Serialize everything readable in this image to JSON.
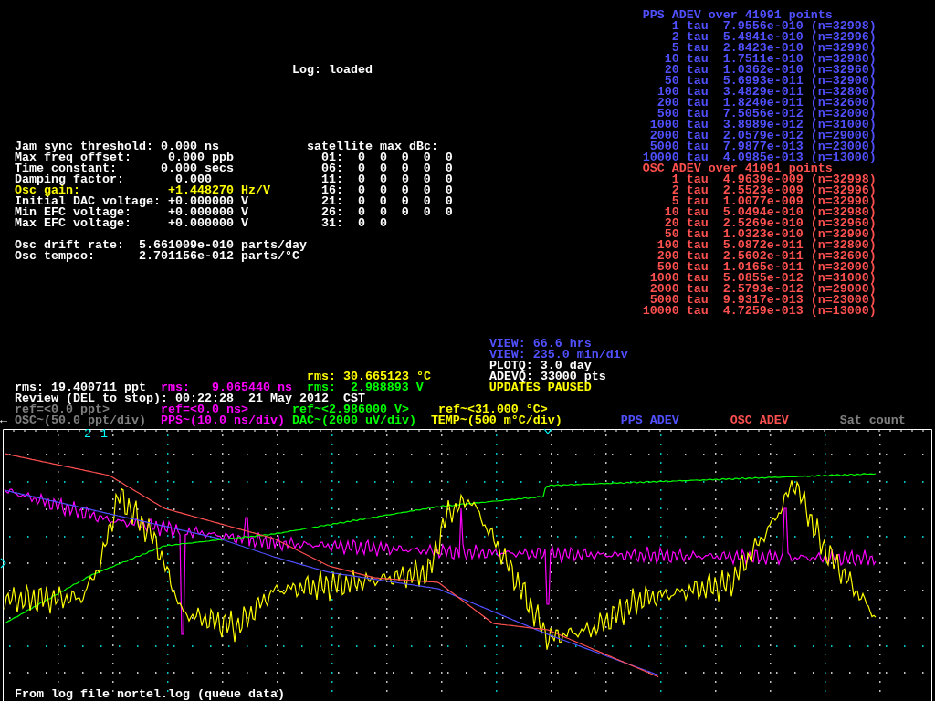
{
  "status": "Log: loaded",
  "receiver_settings": [
    {
      "label": "Jam sync threshold:",
      "value": "0.000 ns",
      "highlighted": false
    },
    {
      "label": "Max freq offset:",
      "value": "0.000 ppb",
      "highlighted": false
    },
    {
      "label": "Time constant:",
      "value": "0.000 secs",
      "highlighted": false
    },
    {
      "label": "Damping factor:",
      "value": "0.000",
      "highlighted": false
    },
    {
      "label": "Osc gain:",
      "value": "+1.448270 Hz/V",
      "highlighted": true
    },
    {
      "label": "Initial DAC voltage:",
      "value": "+0.000000 V",
      "highlighted": false
    },
    {
      "label": "Min EFC voltage:",
      "value": "+0.000000 V",
      "highlighted": false
    },
    {
      "label": "Max EFC voltage:",
      "value": "+0.000000 V",
      "highlighted": false
    }
  ],
  "osc_stats": [
    {
      "label": "Osc drift rate:",
      "value": "5.661009e-010 parts/day"
    },
    {
      "label": "Osc tempco:",
      "value": "2.701156e-012 parts/°C"
    }
  ],
  "satellite_table": {
    "title": "satellite max dBc:",
    "rows": [
      {
        "prn": "01:",
        "values": [
          "0",
          "0",
          "0",
          "0",
          "0"
        ]
      },
      {
        "prn": "06:",
        "values": [
          "0",
          "0",
          "0",
          "0",
          "0"
        ]
      },
      {
        "prn": "11:",
        "values": [
          "0",
          "0",
          "0",
          "0",
          "0"
        ]
      },
      {
        "prn": "16:",
        "values": [
          "0",
          "0",
          "0",
          "0",
          "0"
        ]
      },
      {
        "prn": "21:",
        "values": [
          "0",
          "0",
          "0",
          "0",
          "0"
        ]
      },
      {
        "prn": "26:",
        "values": [
          "0",
          "0",
          "0",
          "0",
          "0"
        ]
      },
      {
        "prn": "31:",
        "values": [
          "0",
          "0"
        ]
      }
    ]
  },
  "adev_tables": [
    {
      "title": "PPS ADEV over 41091 points",
      "color": "#5050ff",
      "rows": [
        {
          "tau": "1",
          "unit": "tau",
          "value": "7.9556e-010",
          "count": "(n=32998)"
        },
        {
          "tau": "2",
          "unit": "tau",
          "value": "5.4841e-010",
          "count": "(n=32996)"
        },
        {
          "tau": "5",
          "unit": "tau",
          "value": "2.8423e-010",
          "count": "(n=32990)"
        },
        {
          "tau": "10",
          "unit": "tau",
          "value": "1.7511e-010",
          "count": "(n=32980)"
        },
        {
          "tau": "20",
          "unit": "tau",
          "value": "1.0362e-010",
          "count": "(n=32960)"
        },
        {
          "tau": "50",
          "unit": "tau",
          "value": "5.6993e-011",
          "count": "(n=32900)"
        },
        {
          "tau": "100",
          "unit": "tau",
          "value": "3.4829e-011",
          "count": "(n=32800)"
        },
        {
          "tau": "200",
          "unit": "tau",
          "value": "1.8240e-011",
          "count": "(n=32600)"
        },
        {
          "tau": "500",
          "unit": "tau",
          "value": "7.5056e-012",
          "count": "(n=32000)"
        },
        {
          "tau": "1000",
          "unit": "tau",
          "value": "3.8989e-012",
          "count": "(n=31000)"
        },
        {
          "tau": "2000",
          "unit": "tau",
          "value": "2.0579e-012",
          "count": "(n=29000)"
        },
        {
          "tau": "5000",
          "unit": "tau",
          "value": "7.9877e-013",
          "count": "(n=23000)"
        },
        {
          "tau": "10000",
          "unit": "tau",
          "value": "4.0985e-013",
          "count": "(n=13000)"
        }
      ]
    },
    {
      "title": "OSC ADEV over 41091 points",
      "color": "#ff5050",
      "rows": [
        {
          "tau": "1",
          "unit": "tau",
          "value": "4.9639e-009",
          "count": "(n=32998)"
        },
        {
          "tau": "2",
          "unit": "tau",
          "value": "2.5523e-009",
          "count": "(n=32996)"
        },
        {
          "tau": "5",
          "unit": "tau",
          "value": "1.0077e-009",
          "count": "(n=32990)"
        },
        {
          "tau": "10",
          "unit": "tau",
          "value": "5.0494e-010",
          "count": "(n=32980)"
        },
        {
          "tau": "20",
          "unit": "tau",
          "value": "2.5269e-010",
          "count": "(n=32960)"
        },
        {
          "tau": "50",
          "unit": "tau",
          "value": "1.0323e-010",
          "count": "(n=32900)"
        },
        {
          "tau": "100",
          "unit": "tau",
          "value": "5.0872e-011",
          "count": "(n=32800)"
        },
        {
          "tau": "200",
          "unit": "tau",
          "value": "2.5602e-011",
          "count": "(n=32600)"
        },
        {
          "tau": "500",
          "unit": "tau",
          "value": "1.0165e-011",
          "count": "(n=32000)"
        },
        {
          "tau": "1000",
          "unit": "tau",
          "value": "5.0855e-012",
          "count": "(n=31000)"
        },
        {
          "tau": "2000",
          "unit": "tau",
          "value": "2.5793e-012",
          "count": "(n=29000)"
        },
        {
          "tau": "5000",
          "unit": "tau",
          "value": "9.9317e-013",
          "count": "(n=23000)"
        },
        {
          "tau": "10000",
          "unit": "tau",
          "value": "4.7259e-013",
          "count": "(n=13000)"
        }
      ]
    }
  ],
  "view_info": [
    {
      "text": "VIEW: 66.6 hrs",
      "color": "#5050ff"
    },
    {
      "text": "VIEW: 235.0 min/div",
      "color": "#5050ff"
    },
    {
      "text": "PLOTQ: 3.0 day",
      "color": "#ffffff"
    },
    {
      "text": "ADEVQ: 33000 pts",
      "color": "#ffffff"
    },
    {
      "text": "UPDATES PAUSED",
      "color": "#ffff00"
    }
  ],
  "rms_readings": [
    {
      "text": "rms: 30.665123 °C",
      "color": "#ffff00"
    },
    {
      "text": "rms: 19.400711 ppt",
      "color": "#ffffff"
    },
    {
      "text": "rms:   9.065440 ns",
      "color": "#ff00ff"
    },
    {
      "text": "rms:  2.988893 V",
      "color": "#00ff00"
    }
  ],
  "review": "Review (DEL to stop): 00:22:28  21 May 2012  CST",
  "references": [
    {
      "text": "ref=<0.0 ppt>",
      "color": "#808080"
    },
    {
      "text": "ref=<0.0 ns>",
      "color": "#ff00ff"
    },
    {
      "text": "ref~<2.986000 V>",
      "color": "#00ff00"
    },
    {
      "text": "ref~<31.000 °C>",
      "color": "#ffff00"
    }
  ],
  "scroll_arrow": "←",
  "plot_legend": [
    {
      "text": "OSC~(50.0 ppt/div)",
      "kind": "osc",
      "enabled": false
    },
    {
      "text": "PPS~(10.0 ns/div)",
      "kind": "pps",
      "enabled": true,
      "color": "#ff00ff"
    },
    {
      "text": "DAC~(2000 uV/div)",
      "kind": "dac",
      "enabled": true,
      "color": "#00ff00"
    },
    {
      "text": "TEMP~(500 m°C/div)",
      "kind": "temp",
      "enabled": true,
      "color": "#ffff00"
    },
    {
      "text": "PPS ADEV",
      "kind": "pps_adev",
      "enabled": true,
      "color": "#5050ff"
    },
    {
      "text": "OSC ADEV",
      "kind": "osc_adev",
      "enabled": true,
      "color": "#ff5050"
    },
    {
      "text": "Sat count",
      "kind": "sat",
      "enabled": false
    }
  ],
  "plot_markers": [
    "2",
    "1"
  ],
  "footer": "From log file nortel.log (queue data)"
}
